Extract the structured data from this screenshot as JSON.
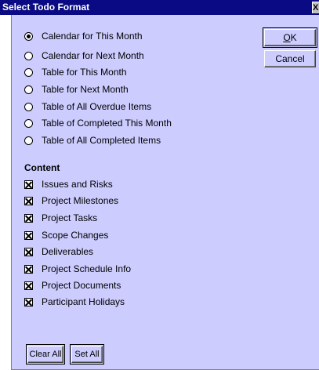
{
  "window": {
    "title": "Select Todo Format",
    "close_glyph": "X"
  },
  "format_options": [
    {
      "label": "Calendar for This Month",
      "checked": true
    },
    {
      "label": "Calendar for Next Month",
      "checked": false
    },
    {
      "label": "Table for This Month",
      "checked": false
    },
    {
      "label": "Table for Next Month",
      "checked": false
    },
    {
      "label": "Table of All Overdue Items",
      "checked": false
    },
    {
      "label": "Table of Completed This Month",
      "checked": false
    },
    {
      "label": "Table of All Completed Items",
      "checked": false
    }
  ],
  "content": {
    "title": "Content",
    "items": [
      {
        "label": "Issues and Risks",
        "checked": true
      },
      {
        "label": "Project Milestones",
        "checked": true
      },
      {
        "label": "Project Tasks",
        "checked": true
      },
      {
        "label": "Scope Changes",
        "checked": true
      },
      {
        "label": "Deliverables",
        "checked": true
      },
      {
        "label": "Project Schedule Info",
        "checked": true
      },
      {
        "label": "Project Documents",
        "checked": true
      },
      {
        "label": "Participant Holidays",
        "checked": true
      }
    ]
  },
  "buttons": {
    "ok_label": "OK",
    "cancel_label": "Cancel",
    "clear_all_label": "Clear All",
    "set_all_label": "Set All"
  },
  "colors": {
    "title_bar": "#0a0a84",
    "client_background": "#ccccff"
  }
}
